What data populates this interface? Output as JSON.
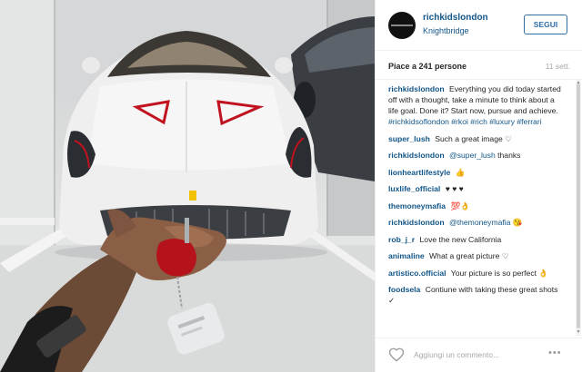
{
  "header": {
    "username": "richkidslondon",
    "location": "Knightbridge",
    "follow_label": "SEGUI"
  },
  "meta": {
    "likes": "Piace a 241 persone",
    "time": "11 sett."
  },
  "caption": {
    "user": "richkidslondon",
    "text": "Everything you did today started off with a thought, take a minute to think about a life goal. Done it? Start now, pursue and achieve.",
    "hashtags": "#richkidsoflondon #rkoi #rich #luxury #ferrari"
  },
  "comments": [
    {
      "user": "super_lush",
      "text": "Such a great image ♡"
    },
    {
      "user": "richkidslondon",
      "mention": "@super_lush",
      "text": "thanks"
    },
    {
      "user": "lionheartlifestyle",
      "text": "👍"
    },
    {
      "user": "luxlife_official",
      "text": "♥ ♥ ♥"
    },
    {
      "user": "themoneymafia",
      "text": "💯👌"
    },
    {
      "user": "richkidslondon",
      "mention": "@themoneymafia",
      "text": "😘"
    },
    {
      "user": "rob_j_r",
      "text": "Love the new California"
    },
    {
      "user": "animaline",
      "text": "What a great picture ♡"
    },
    {
      "user": "artistico.official",
      "text": "Your picture is so perfect 👌"
    },
    {
      "user": "foodsela",
      "text": "Contiune with taking these great shots ✓"
    }
  ],
  "footer": {
    "comment_placeholder": "Aggiungi un commento...",
    "more_label": "•••"
  },
  "icons": {
    "heart": "heart-icon",
    "more": "more-options-icon"
  },
  "colors": {
    "link": "#125688",
    "follow": "#2e6ea5",
    "car": "#eeeeee",
    "accent_red": "#c1121f"
  }
}
